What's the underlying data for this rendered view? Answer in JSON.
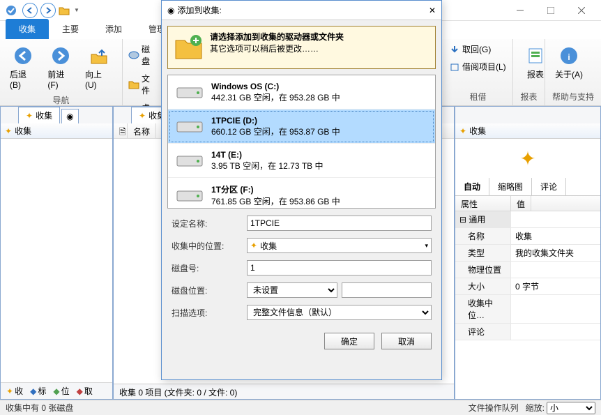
{
  "tabs": {
    "t1": "收集",
    "t2": "主要",
    "t3": "添加",
    "t4": "管理"
  },
  "ribbon": {
    "nav_back": "后退(B)",
    "nav_fwd": "前进(F)",
    "nav_up": "向上(U)",
    "group_nav": "导航",
    "disk": "磁盘",
    "file": "文件",
    "virt": "虚拟",
    "get_back": "取回(G)",
    "borrow": "借阅项目(L)",
    "group_rent": "租借",
    "report": "报表",
    "about": "关于(A)",
    "group_help": "帮助与支持"
  },
  "left": {
    "tab": "收集",
    "header": "收集",
    "bt1": "收",
    "bt2": "标",
    "bt3": "位",
    "bt4": "取"
  },
  "mid": {
    "tab": "收集",
    "col_name": "名称",
    "status": "收集  0 项目  (文件夹: 0 / 文件: 0)"
  },
  "right": {
    "header": "收集",
    "sub_auto": "自动",
    "sub_thumb": "缩略图",
    "sub_comment": "评论",
    "hdr_prop": "属性",
    "hdr_val": "值",
    "group_general": "通用",
    "rows": [
      {
        "k": "名称",
        "v": "收集"
      },
      {
        "k": "类型",
        "v": "我的收集文件夹"
      },
      {
        "k": "物理位置",
        "v": ""
      },
      {
        "k": "大小",
        "v": "0 字节"
      },
      {
        "k": "收集中位…",
        "v": ""
      },
      {
        "k": "评论",
        "v": ""
      }
    ]
  },
  "status": {
    "left": "收集中有 0 张磁盘",
    "queue": "文件操作队列",
    "zoom_lbl": "缩放:",
    "zoom_val": "小"
  },
  "modal": {
    "title": "添加到收集:",
    "banner_line1": "请选择添加到收集的驱动器或文件夹",
    "banner_line2": "其它选项可以稍后被更改……",
    "drives": [
      {
        "name": "Windows OS (C:)",
        "info": "442.31 GB 空闲，在 953.28 GB 中",
        "selected": false
      },
      {
        "name": "1TPCIE (D:)",
        "info": "660.12 GB 空闲，在 953.87 GB 中",
        "selected": true
      },
      {
        "name": "14T (E:)",
        "info": "3.95 TB 空闲，在 12.73 TB 中",
        "selected": false
      },
      {
        "name": "1T分区 (F:)",
        "info": "761.85 GB 空闲，在 953.86 GB 中",
        "selected": false
      }
    ],
    "lbl_devname": "设定名称:",
    "val_devname": "1TPCIE",
    "lbl_collect_loc": "收集中的位置:",
    "val_collect_loc": "收集",
    "lbl_diskno": "磁盘号:",
    "val_diskno": "1",
    "lbl_diskloc": "磁盘位置:",
    "val_diskloc": "未设置",
    "lbl_scan": "扫描选项:",
    "val_scan": "完整文件信息（默认）",
    "btn_ok": "确定",
    "btn_cancel": "取消"
  }
}
